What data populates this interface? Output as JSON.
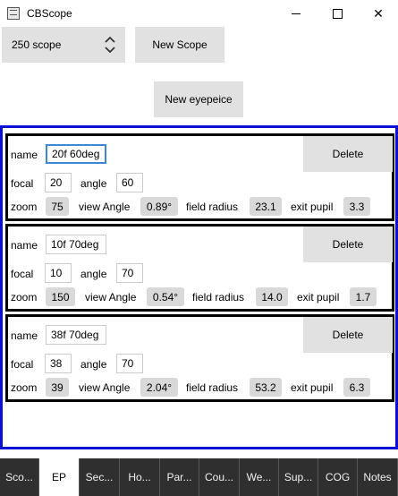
{
  "window": {
    "title": "CBScope"
  },
  "toolbar": {
    "scope_value": "250 scope",
    "new_scope_label": "New Scope",
    "new_eyepiece_label": "New eyepeice"
  },
  "labels": {
    "name": "name",
    "focal": "focal",
    "angle": "angle",
    "zoom": "zoom",
    "view_angle": "view Angle",
    "field_radius": "field radius",
    "exit_pupil": "exit pupil",
    "delete": "Delete"
  },
  "eyepieces": [
    {
      "name": "20f 60deg",
      "focal": "20",
      "angle": "60",
      "zoom": "75",
      "view_angle": "0.89°",
      "field_radius": "23.1",
      "exit_pupil": "3.3"
    },
    {
      "name": "10f 70deg",
      "focal": "10",
      "angle": "70",
      "zoom": "150",
      "view_angle": "0.54°",
      "field_radius": "14.0",
      "exit_pupil": "1.7"
    },
    {
      "name": "38f 70deg",
      "focal": "38",
      "angle": "70",
      "zoom": "39",
      "view_angle": "2.04°",
      "field_radius": "53.2",
      "exit_pupil": "6.3"
    }
  ],
  "tabs": [
    {
      "label": "Sco...",
      "active": false
    },
    {
      "label": "EP",
      "active": true
    },
    {
      "label": "Sec...",
      "active": false
    },
    {
      "label": "Ho...",
      "active": false
    },
    {
      "label": "Par...",
      "active": false
    },
    {
      "label": "Cou...",
      "active": false
    },
    {
      "label": "We...",
      "active": false
    },
    {
      "label": "Sup...",
      "active": false
    },
    {
      "label": "COG",
      "active": false
    },
    {
      "label": "Notes",
      "active": false
    }
  ],
  "colors": {
    "panel_border": "#0a10d8",
    "focus_border": "#3c88d8",
    "tab_bg": "#2f2f2f"
  }
}
